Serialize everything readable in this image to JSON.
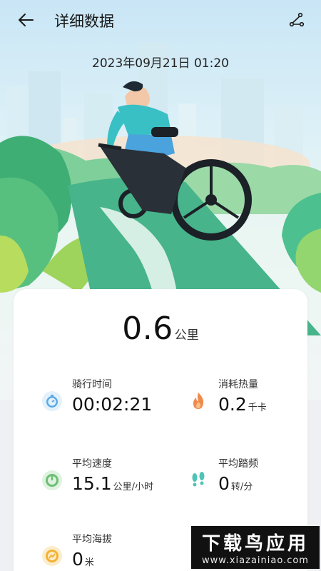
{
  "header": {
    "title": "详细数据",
    "back_icon": "arrow-left-icon",
    "share_icon": "share-icon"
  },
  "activity": {
    "datetime": "2023年09月21日 01:20"
  },
  "summary": {
    "distance_value": "0.6",
    "distance_unit": "公里"
  },
  "stats": {
    "duration": {
      "label": "骑行时间",
      "value": "00:02:21",
      "unit": "",
      "icon": "stopwatch-icon",
      "color": "#5aa9e6"
    },
    "calories": {
      "label": "消耗热量",
      "value": "0.2",
      "unit": "千卡",
      "icon": "flame-icon",
      "color": "#f08a4b"
    },
    "avg_speed": {
      "label": "平均速度",
      "value": "15.1",
      "unit": "公里/小时",
      "icon": "speedometer-icon",
      "color": "#6cbf73"
    },
    "avg_cadence": {
      "label": "平均踏频",
      "value": "0",
      "unit": "转/分",
      "icon": "footprints-icon",
      "color": "#4fc3b5"
    },
    "avg_altitude": {
      "label": "平均海拔",
      "value": "0",
      "unit": "米",
      "icon": "altitude-icon",
      "color": "#f2b233"
    }
  },
  "watermark": {
    "title": "下载鸟应用",
    "url": "www.xiazainiao.com"
  }
}
